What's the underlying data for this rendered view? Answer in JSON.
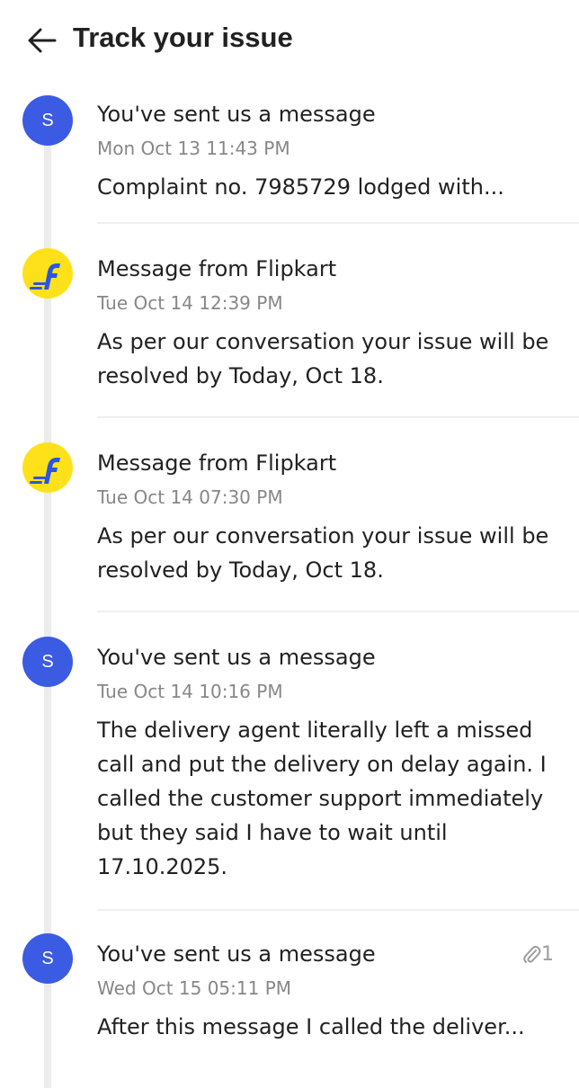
{
  "header": {
    "title": "Track your issue",
    "back_icon": "arrow-left-icon"
  },
  "entries": [
    {
      "avatar": "S",
      "title": "You've sent us a message",
      "time": "Mon Oct 13 11:43 PM",
      "body": "Complaint no. 7985729 lodged with..."
    },
    {
      "avatar": "flipkart-logo",
      "title": "Message from Flipkart",
      "time": "Tue Oct 14 12:39 PM",
      "body": "As per our conversation your issue will be resolved by Today, Oct 18."
    },
    {
      "avatar": "flipkart-logo",
      "title": "Message from Flipkart",
      "time": "Tue Oct 14 07:30 PM",
      "body": "As per our conversation your issue will be resolved by Today, Oct 18."
    },
    {
      "avatar": "S",
      "title": "You've sent us a message",
      "time": "Tue Oct 14 10:16 PM",
      "body": "The delivery agent literally left a missed call and put the delivery on delay again. I called the customer support immediately but they said I have to wait until 17.10.2025."
    },
    {
      "avatar": "S",
      "title": "You've sent us a message",
      "time": "Wed Oct 15 05:11 PM",
      "body": "After this message I called the deliver...",
      "attachment_count": "1",
      "attachment_icon": "paperclip-icon"
    }
  ],
  "colors": {
    "user_avatar": "#3b5be3",
    "flipkart_yellow": "#ffe11b",
    "flipkart_blue": "#2a55e5",
    "timeline": "#ececec",
    "muted_text": "#878787"
  }
}
